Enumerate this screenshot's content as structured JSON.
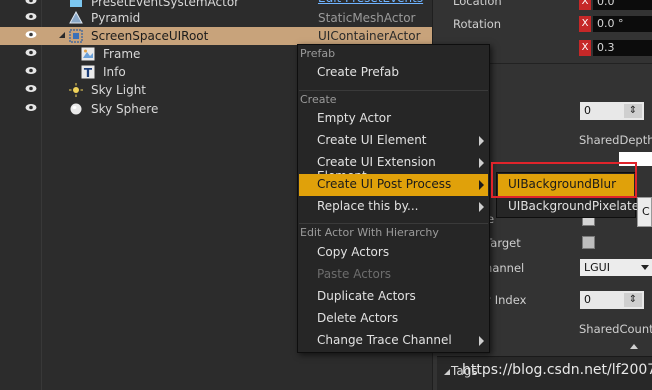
{
  "outliner": {
    "rows": [
      {
        "label": "PresetEventSystemActor",
        "type": "Edit PresetEvents"
      },
      {
        "label": "Pyramid",
        "type": "StaticMeshActor"
      },
      {
        "label": "ScreenSpaceUIRoot",
        "type": "UIContainerActor"
      },
      {
        "label": "Frame"
      },
      {
        "label": "Info"
      },
      {
        "label": "Sky Light"
      },
      {
        "label": "Sky Sphere"
      }
    ]
  },
  "details": {
    "location_label": "Location",
    "location_value": "0.0",
    "rotation_label": "Rotation",
    "rotation_value": "0.0 °",
    "scale_value": "0.3",
    "x_label": "X",
    "depth_value": "0",
    "shared_depth_label": "SharedDepthCo",
    "active_label": "ive",
    "raycast_label": "t Target",
    "channel_label": "Channel",
    "channel_value": "LGUI",
    "hierarchy_label": "hy Index",
    "hierarchy_value": "0",
    "shared_count_label": "SharedCount:",
    "tags_label": "Tags"
  },
  "menu": {
    "sections": {
      "prefab": "Prefab",
      "create": "Create",
      "hierarchy": "Edit Actor With Hierarchy"
    },
    "items": {
      "create_prefab": "Create Prefab",
      "empty_actor": "Empty Actor",
      "create_ui_element": "Create UI Element",
      "create_ui_extension": "Create UI Extension Element",
      "create_ui_post": "Create UI Post Process",
      "replace": "Replace this by...",
      "copy": "Copy Actors",
      "paste": "Paste Actors",
      "duplicate": "Duplicate Actors",
      "delete": "Delete Actors",
      "change_trace": "Change Trace Channel"
    }
  },
  "submenu": {
    "items": [
      "UIBackgroundBlur",
      "UIBackgroundPixelate"
    ]
  },
  "tooltip_fragment": "C",
  "watermark": "https://blog.csdn.net/lf2007hf",
  "colors": {
    "selection": "#c8a37b",
    "highlight": "#e0a10a",
    "callout": "#e0242b"
  }
}
